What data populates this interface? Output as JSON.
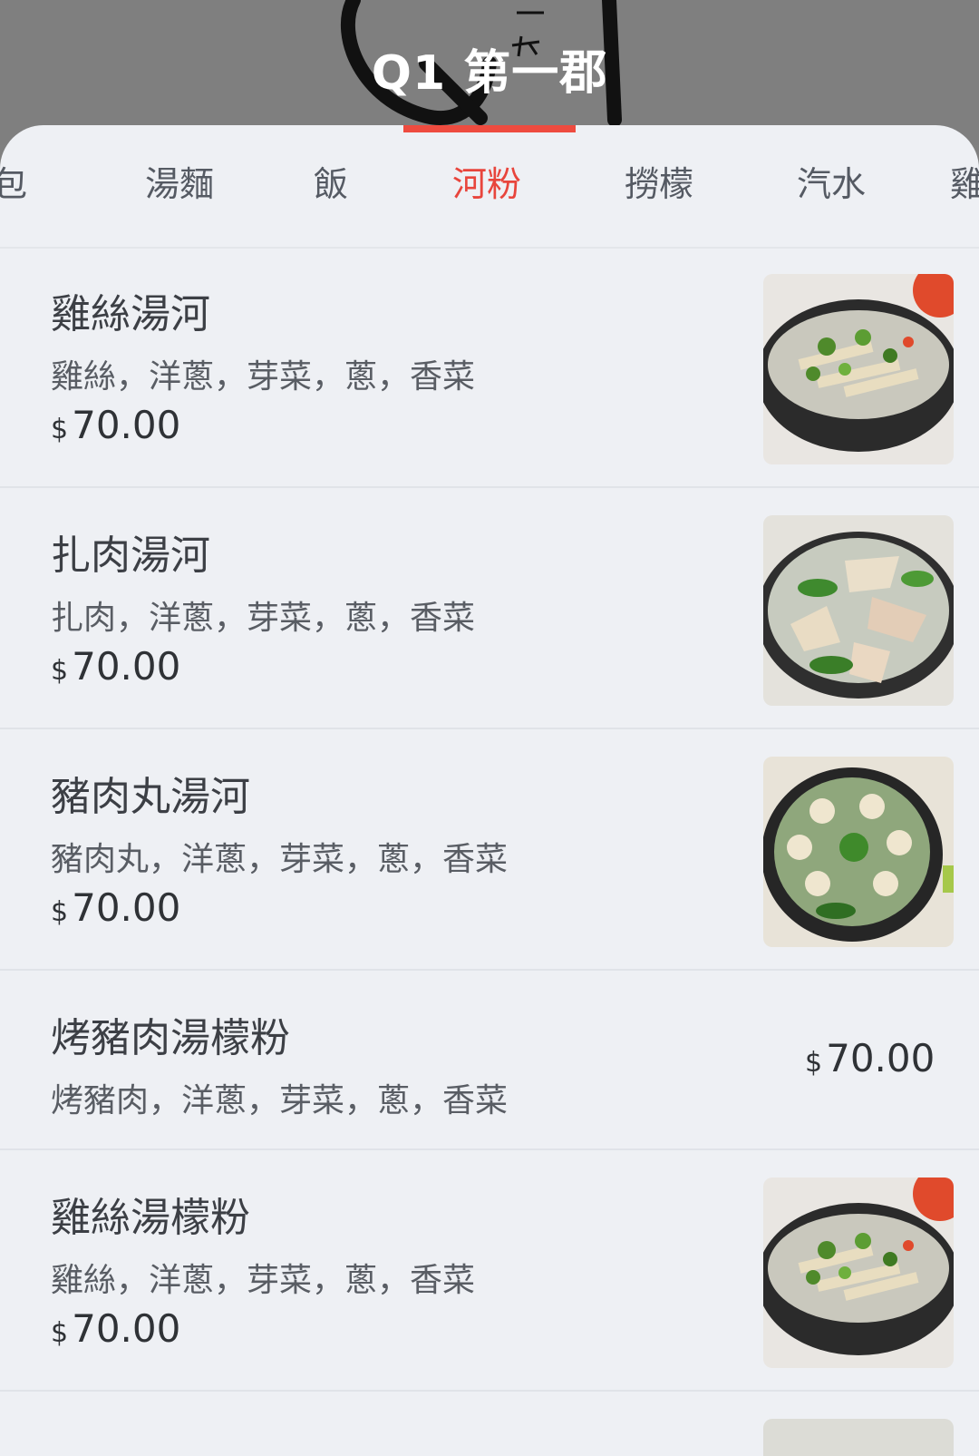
{
  "header": {
    "title": "Q1 第一郡"
  },
  "tabs": [
    {
      "label": "軟包",
      "active": false
    },
    {
      "label": "湯麵",
      "active": false
    },
    {
      "label": "飯",
      "active": false
    },
    {
      "label": "河粉",
      "active": true
    },
    {
      "label": "撈檬",
      "active": false
    },
    {
      "label": "汽水",
      "active": false
    },
    {
      "label": "雞",
      "active": false
    }
  ],
  "colors": {
    "accent": "#e8453c",
    "background": "#eef0f4",
    "header": "#7f7f7f"
  },
  "items": [
    {
      "name": "雞絲湯河",
      "desc": "雞絲，洋蔥，芽菜，蔥，香菜",
      "currency": "$",
      "price": "70.00",
      "image": "chicken-pho-image"
    },
    {
      "name": "扎肉湯河",
      "desc": "扎肉，洋蔥，芽菜，蔥，香菜",
      "currency": "$",
      "price": "70.00",
      "image": "pork-roll-pho-image"
    },
    {
      "name": "豬肉丸湯河",
      "desc": "豬肉丸，洋蔥，芽菜，蔥，香菜",
      "currency": "$",
      "price": "70.00",
      "image": "pork-ball-pho-image"
    },
    {
      "name": "烤豬肉湯檬粉",
      "desc": "烤豬肉，洋蔥，芽菜，蔥，香菜",
      "currency": "$",
      "price": "70.00",
      "image": ""
    },
    {
      "name": "雞絲湯檬粉",
      "desc": "雞絲，洋蔥，芽菜，蔥，香菜",
      "currency": "$",
      "price": "70.00",
      "image": "chicken-vermicelli-image"
    }
  ]
}
